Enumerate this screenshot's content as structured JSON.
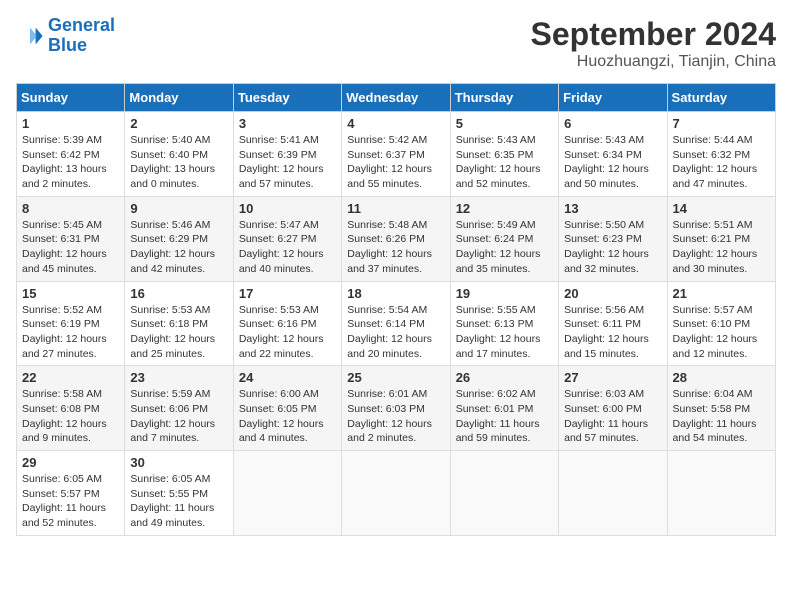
{
  "header": {
    "logo_line1": "General",
    "logo_line2": "Blue",
    "month_year": "September 2024",
    "location": "Huozhuangzi, Tianjin, China"
  },
  "days_of_week": [
    "Sunday",
    "Monday",
    "Tuesday",
    "Wednesday",
    "Thursday",
    "Friday",
    "Saturday"
  ],
  "weeks": [
    [
      {
        "day": "1",
        "info": "Sunrise: 5:39 AM\nSunset: 6:42 PM\nDaylight: 13 hours\nand 2 minutes."
      },
      {
        "day": "2",
        "info": "Sunrise: 5:40 AM\nSunset: 6:40 PM\nDaylight: 13 hours\nand 0 minutes."
      },
      {
        "day": "3",
        "info": "Sunrise: 5:41 AM\nSunset: 6:39 PM\nDaylight: 12 hours\nand 57 minutes."
      },
      {
        "day": "4",
        "info": "Sunrise: 5:42 AM\nSunset: 6:37 PM\nDaylight: 12 hours\nand 55 minutes."
      },
      {
        "day": "5",
        "info": "Sunrise: 5:43 AM\nSunset: 6:35 PM\nDaylight: 12 hours\nand 52 minutes."
      },
      {
        "day": "6",
        "info": "Sunrise: 5:43 AM\nSunset: 6:34 PM\nDaylight: 12 hours\nand 50 minutes."
      },
      {
        "day": "7",
        "info": "Sunrise: 5:44 AM\nSunset: 6:32 PM\nDaylight: 12 hours\nand 47 minutes."
      }
    ],
    [
      {
        "day": "8",
        "info": "Sunrise: 5:45 AM\nSunset: 6:31 PM\nDaylight: 12 hours\nand 45 minutes."
      },
      {
        "day": "9",
        "info": "Sunrise: 5:46 AM\nSunset: 6:29 PM\nDaylight: 12 hours\nand 42 minutes."
      },
      {
        "day": "10",
        "info": "Sunrise: 5:47 AM\nSunset: 6:27 PM\nDaylight: 12 hours\nand 40 minutes."
      },
      {
        "day": "11",
        "info": "Sunrise: 5:48 AM\nSunset: 6:26 PM\nDaylight: 12 hours\nand 37 minutes."
      },
      {
        "day": "12",
        "info": "Sunrise: 5:49 AM\nSunset: 6:24 PM\nDaylight: 12 hours\nand 35 minutes."
      },
      {
        "day": "13",
        "info": "Sunrise: 5:50 AM\nSunset: 6:23 PM\nDaylight: 12 hours\nand 32 minutes."
      },
      {
        "day": "14",
        "info": "Sunrise: 5:51 AM\nSunset: 6:21 PM\nDaylight: 12 hours\nand 30 minutes."
      }
    ],
    [
      {
        "day": "15",
        "info": "Sunrise: 5:52 AM\nSunset: 6:19 PM\nDaylight: 12 hours\nand 27 minutes."
      },
      {
        "day": "16",
        "info": "Sunrise: 5:53 AM\nSunset: 6:18 PM\nDaylight: 12 hours\nand 25 minutes."
      },
      {
        "day": "17",
        "info": "Sunrise: 5:53 AM\nSunset: 6:16 PM\nDaylight: 12 hours\nand 22 minutes."
      },
      {
        "day": "18",
        "info": "Sunrise: 5:54 AM\nSunset: 6:14 PM\nDaylight: 12 hours\nand 20 minutes."
      },
      {
        "day": "19",
        "info": "Sunrise: 5:55 AM\nSunset: 6:13 PM\nDaylight: 12 hours\nand 17 minutes."
      },
      {
        "day": "20",
        "info": "Sunrise: 5:56 AM\nSunset: 6:11 PM\nDaylight: 12 hours\nand 15 minutes."
      },
      {
        "day": "21",
        "info": "Sunrise: 5:57 AM\nSunset: 6:10 PM\nDaylight: 12 hours\nand 12 minutes."
      }
    ],
    [
      {
        "day": "22",
        "info": "Sunrise: 5:58 AM\nSunset: 6:08 PM\nDaylight: 12 hours\nand 9 minutes."
      },
      {
        "day": "23",
        "info": "Sunrise: 5:59 AM\nSunset: 6:06 PM\nDaylight: 12 hours\nand 7 minutes."
      },
      {
        "day": "24",
        "info": "Sunrise: 6:00 AM\nSunset: 6:05 PM\nDaylight: 12 hours\nand 4 minutes."
      },
      {
        "day": "25",
        "info": "Sunrise: 6:01 AM\nSunset: 6:03 PM\nDaylight: 12 hours\nand 2 minutes."
      },
      {
        "day": "26",
        "info": "Sunrise: 6:02 AM\nSunset: 6:01 PM\nDaylight: 11 hours\nand 59 minutes."
      },
      {
        "day": "27",
        "info": "Sunrise: 6:03 AM\nSunset: 6:00 PM\nDaylight: 11 hours\nand 57 minutes."
      },
      {
        "day": "28",
        "info": "Sunrise: 6:04 AM\nSunset: 5:58 PM\nDaylight: 11 hours\nand 54 minutes."
      }
    ],
    [
      {
        "day": "29",
        "info": "Sunrise: 6:05 AM\nSunset: 5:57 PM\nDaylight: 11 hours\nand 52 minutes."
      },
      {
        "day": "30",
        "info": "Sunrise: 6:05 AM\nSunset: 5:55 PM\nDaylight: 11 hours\nand 49 minutes."
      },
      {
        "day": "",
        "info": ""
      },
      {
        "day": "",
        "info": ""
      },
      {
        "day": "",
        "info": ""
      },
      {
        "day": "",
        "info": ""
      },
      {
        "day": "",
        "info": ""
      }
    ]
  ]
}
